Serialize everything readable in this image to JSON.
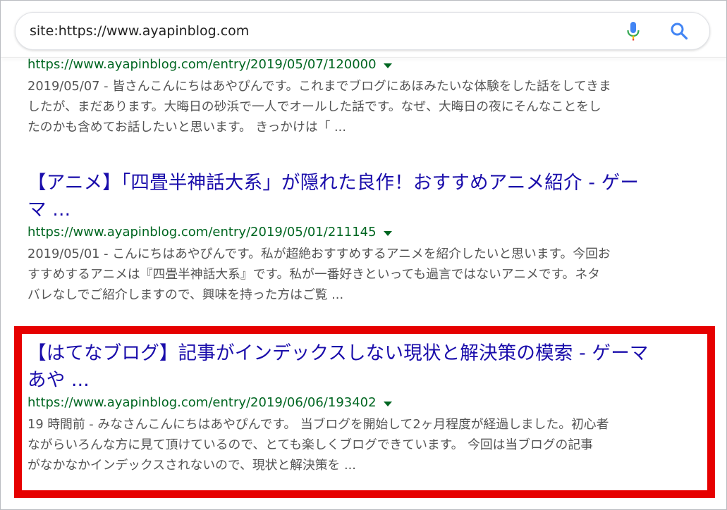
{
  "search": {
    "query": "site:https://www.ayapinblog.com"
  },
  "icons": {
    "mic": "microphone-icon",
    "search": "search-icon",
    "caret": "caret-down-icon"
  },
  "colors": {
    "title": "#1a0dab",
    "url": "#006621",
    "snippet": "#545454",
    "highlight": "#e60000"
  },
  "results": [
    {
      "title": "",
      "url": "https://www.ayapinblog.com/entry/2019/05/07/120000",
      "snippet_lines": [
        "2019/05/07 - 皆さんこんにちはあやぴんです。これまでブログにあほみたいな体験をした話をしてきま",
        "したが、まだあります。大晦日の砂浜で一人でオールした話です。なぜ、大晦日の夜にそんなことをし",
        "たのかも含めてお話したいと思います。 きっかけは「 ..."
      ]
    },
    {
      "title_lines": [
        "【アニメ】「四畳半神話大系」が隠れた良作！おすすめアニメ紹介 - ゲー",
        "マ ..."
      ],
      "url": "https://www.ayapinblog.com/entry/2019/05/01/211145",
      "snippet_lines": [
        "2019/05/01 - こんにちはあやぴんです。私が超絶おすすめするアニメを紹介したいと思います。今回お",
        "すすめするアニメは『四畳半神話大系』です。私が一番好きといっても過言ではないアニメです。ネタ",
        "バレなしでご紹介しますので、興味を持った方はご覧 ..."
      ]
    },
    {
      "title_lines": [
        "【はてなブログ】記事がインデックスしない現状と解決策の模索 - ゲーマ",
        "あや ..."
      ],
      "url": "https://www.ayapinblog.com/entry/2019/06/06/193402",
      "snippet_lines": [
        "19 時間前 - みなさんこんにちはあやぴんです。 当ブログを開始して2ヶ月程度が経過しました。初心者",
        "ながらいろんな方に見て頂けているので、とても楽しくブログできています。 今回は当ブログの記事",
        "がなかなかインデックスされないので、現状と解決策を ..."
      ],
      "highlighted": true
    }
  ]
}
